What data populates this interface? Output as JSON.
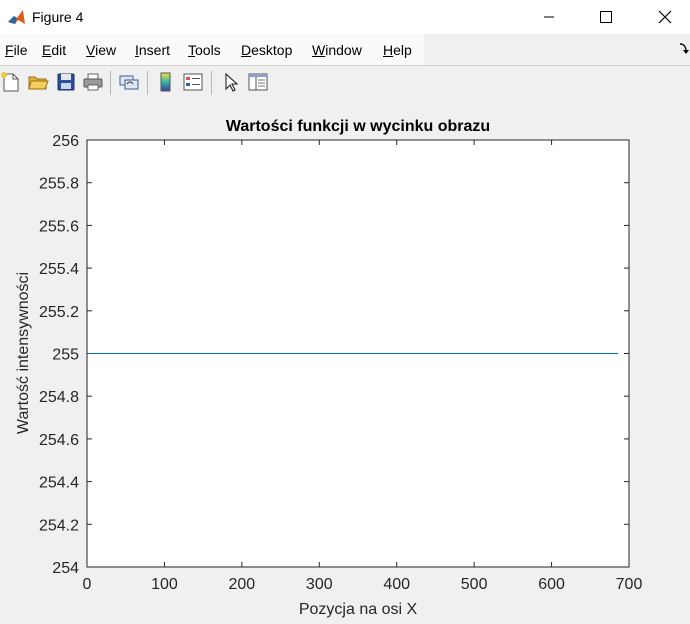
{
  "window": {
    "title": "Figure 4",
    "icon": "matlab-logo-icon",
    "controls": [
      "minimize-icon",
      "maximize-icon",
      "close-icon"
    ]
  },
  "menu": {
    "items": [
      {
        "label": "File",
        "mnemonic": "F",
        "rest": "ile"
      },
      {
        "label": "Edit",
        "mnemonic": "E",
        "rest": "dit"
      },
      {
        "label": "View",
        "mnemonic": "V",
        "rest": "iew"
      },
      {
        "label": "Insert",
        "mnemonic": "I",
        "rest": "nsert"
      },
      {
        "label": "Tools",
        "mnemonic": "T",
        "rest": "ools"
      },
      {
        "label": "Desktop",
        "mnemonic": "D",
        "rest": "esktop"
      },
      {
        "label": "Window",
        "mnemonic": "W",
        "rest": "indow"
      },
      {
        "label": "Help",
        "mnemonic": "H",
        "rest": "elp"
      }
    ]
  },
  "toolbar": {
    "icons": [
      "new-figure-icon",
      "open-file-icon",
      "save-icon",
      "print-icon",
      "link-plot-icon",
      "colorbar-icon",
      "legend-icon",
      "edit-plot-icon",
      "property-inspector-icon"
    ]
  },
  "colors": {
    "line": "#0072bd",
    "axes_bg": "#ffffff",
    "figure_bg": "#f0f0f0"
  },
  "chart_data": {
    "type": "line",
    "title": "Wartości funkcji w wycinku obrazu",
    "xlabel": "Pozycja na osi X",
    "ylabel": "Wartość intensywności",
    "xlim": [
      0,
      700
    ],
    "ylim": [
      254,
      256
    ],
    "xticks": [
      0,
      100,
      200,
      300,
      400,
      500,
      600,
      700
    ],
    "yticks": [
      254,
      254.2,
      254.4,
      254.6,
      254.8,
      255,
      255.2,
      255.4,
      255.6,
      255.8,
      256
    ],
    "xtick_labels": [
      "0",
      "100",
      "200",
      "300",
      "400",
      "500",
      "600",
      "700"
    ],
    "ytick_labels": [
      "254",
      "254.2",
      "254.4",
      "254.6",
      "254.8",
      "255",
      "255.2",
      "255.4",
      "255.6",
      "255.8",
      "256"
    ],
    "grid": false,
    "series": [
      {
        "x": [
          1,
          686
        ],
        "y": [
          255,
          255
        ]
      }
    ]
  }
}
